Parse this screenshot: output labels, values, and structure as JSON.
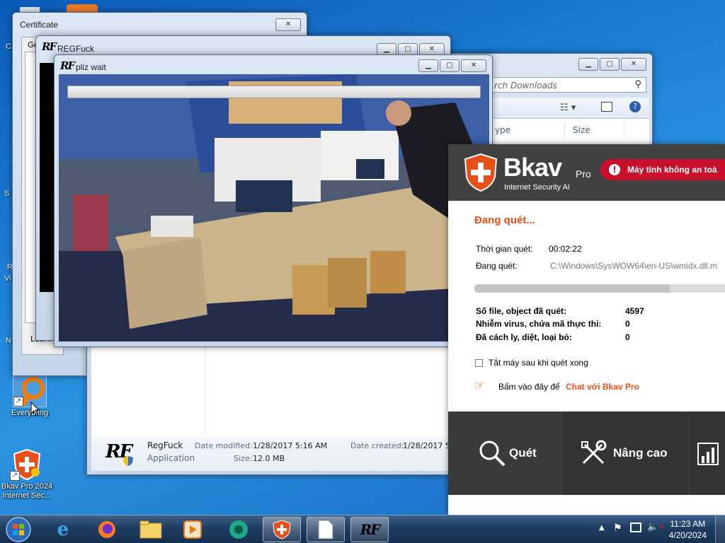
{
  "desktop": {
    "icons": [
      {
        "label": "Everything"
      },
      {
        "label": "Bkav Pro 2024 Internet Sec..."
      }
    ],
    "edge_letters": [
      "C",
      "S",
      "R",
      "Vi",
      "N"
    ]
  },
  "certificate_window": {
    "title": "Certificate",
    "tab_label": "Ge",
    "link_text": "Learn m"
  },
  "regfuck_window": {
    "title": "REGFuck"
  },
  "pliz_window": {
    "title": "pliz wait"
  },
  "explorer_window": {
    "search_placeholder": "rch Downloads",
    "columns": [
      "ype",
      "Size"
    ],
    "details": {
      "name": "RegFuck",
      "type": "Application",
      "modified_label": "Date modified:",
      "modified_value": "1/28/2017 5:16 AM",
      "created_label": "Date created:",
      "created_value": "1/28/2017 5:",
      "size_label": "Size:",
      "size_value": "12.0 MB"
    }
  },
  "bkav": {
    "logo_text": "Bkav",
    "pro_label": "Pro",
    "product_line": "Internet Security AI",
    "alert_text": "Máy tính không an toà",
    "status": "Đang quét...",
    "scan_time_label": "Thời gian quét:",
    "scan_time_value": "00:02:22",
    "scanning_label": "Đang quét:",
    "scanning_path": "C:\\Windows\\SysWOW64\\en-US\\wmidx.dll.m",
    "progress": 0.78,
    "stats": [
      {
        "label": "Số file, object đã quét:",
        "value": "4597"
      },
      {
        "label": "Nhiễm virus, chứa mã thực thi:",
        "value": "0"
      },
      {
        "label": "Đã cách ly, diệt, loại bỏ:",
        "value": "0"
      }
    ],
    "shutdown_checkbox_label": "Tắt máy sau khi quét xong",
    "shutdown_checked": false,
    "chat_prefix": "Bấm vào đây để ",
    "chat_link": "Chat với Bkav Pro",
    "nav": [
      {
        "label": "Quét",
        "icon": "magnifier-icon"
      },
      {
        "label": "Nâng cao",
        "icon": "tools-icon"
      }
    ],
    "colors": {
      "accent": "#e8501a",
      "header": "#414141",
      "alert": "#c8102e"
    }
  },
  "taskbar": {
    "time": "11:23 AM",
    "date": "4/20/2024"
  }
}
